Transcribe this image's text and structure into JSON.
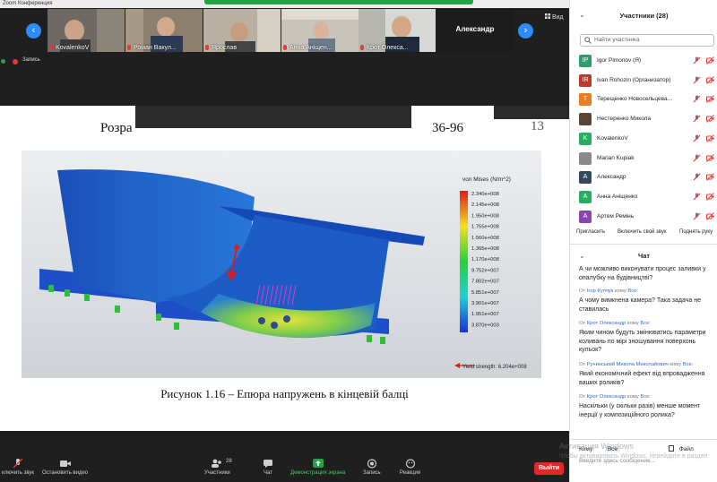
{
  "window": {
    "title": "Zoom Конференция"
  },
  "thumbnails": [
    {
      "name": "KovalenkoV"
    },
    {
      "name": "Роман Вакул..."
    },
    {
      "name": "Ярослав"
    },
    {
      "name": "Анна Аніщен..."
    },
    {
      "name": "Крот Олекса..."
    },
    {
      "name": "Александр"
    }
  ],
  "view_label": "Вид",
  "record_label": "Запись",
  "document": {
    "heading_start": "Розра",
    "heading_end": "36-96",
    "page_number": "13",
    "caption": "Рисунок 1.16 – Епюра напружень в кінцевій балці",
    "legend": {
      "title": "von Mises (N/m^2)",
      "values": [
        "2.340e+008",
        "2.145e+008",
        "1.950e+008",
        "1.755e+008",
        "1.560e+008",
        "1.365e+008",
        "1.170e+008",
        "9.752e+007",
        "7.802e+007",
        "5.851e+007",
        "3.901e+007",
        "1.951e+007",
        "3.870e+003"
      ],
      "yield": "Yield strength: 6.204e+008"
    }
  },
  "toolbar": {
    "unmute": "ключить звук",
    "video": "Остановить видео",
    "participants_count": "28",
    "participants": "Участники",
    "chat": "Чат",
    "share": "Демонстрация экрана",
    "record": "Запись",
    "reactions": "Реакции",
    "leave": "Выйти"
  },
  "participants_panel": {
    "title": "Участники (28)",
    "search_placeholder": "Найти участника",
    "list": [
      {
        "initials": "IP",
        "name": "Igor Pimonov (Я)",
        "color": "#2e9d6b"
      },
      {
        "initials": "IR",
        "name": "Ivan Rohozin (Организатор)",
        "color": "#c0392b"
      },
      {
        "initials": "T",
        "name": "Терещенко Новосельцева...",
        "color": "#e67e22"
      },
      {
        "initials": "",
        "name": "Нестеренко Микола",
        "color": "#5a4636"
      },
      {
        "initials": "K",
        "name": "KovalenkoV",
        "color": "#27ae60"
      },
      {
        "initials": "",
        "name": "Marian Kupiak",
        "color": "#8a8a8a"
      },
      {
        "initials": "A",
        "name": "Александр",
        "color": "#34495e"
      },
      {
        "initials": "A",
        "name": "Анна Аніщенко",
        "color": "#27ae60"
      },
      {
        "initials": "A",
        "name": "Артем Ремінь",
        "color": "#8e44ad"
      }
    ],
    "buttons": [
      "Пригласить",
      "Включить свой звук",
      "Поднять руку"
    ]
  },
  "chat_panel": {
    "title": "Чат",
    "messages": [
      {
        "from": "",
        "to": "",
        "text": "А чи можливо виконувати процес заливки у опалубку на будівництві?"
      },
      {
        "from": "Ігор Купчук",
        "to": "Все",
        "text": "А чому вимкнена камера? Така задача не ставилась"
      },
      {
        "from": "Крот Олександр",
        "to": "Все",
        "text": "Яким чином будуть змінюватись параметри коливань по мірі зношування поверхонь кульок?"
      },
      {
        "from": "Ручинський Микола Миколайович",
        "to": "Все",
        "text": "Який економічний ефект від впровадження ваших роликів?"
      },
      {
        "from": "Крот Олександр",
        "to": "Все",
        "text": "Наскільки (у скільки разів) менше момент інерції у композиційного ролика?"
      }
    ],
    "from_word": "От",
    "to_word": "кому",
    "send_to_label": "Кому:",
    "send_to_value": "Все",
    "file_label": "Файл",
    "input_placeholder": "Введите здесь сообщение..."
  },
  "watermark": {
    "line1": "Активация Windows",
    "line2": "Чтобы активировать Windows, перейдите в раздел"
  }
}
